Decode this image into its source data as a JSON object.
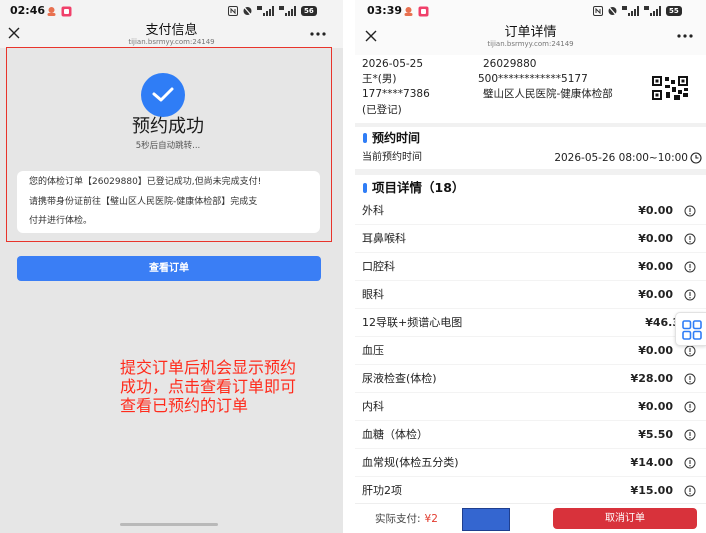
{
  "left_screen": {
    "status_bar": {
      "time": "02:46",
      "battery": "56"
    },
    "header": {
      "title": "支付信息",
      "subtitle": "tijian.bsrmyy.com:24149"
    },
    "success": {
      "title": "预约成功",
      "countdown": "5秒后自动跳转..."
    },
    "notice_lines": [
      "您的体检订单【26029880】已登记成功,但尚未完成支付!",
      "请携带身份证前往【璧山区人民医院-健康体检部】完成支",
      "付并进行体检。"
    ],
    "view_order_button": "查看订单",
    "annotation_lines": [
      "提交订单后机会显示预约",
      "成功，点击查看订单即可",
      "查看已预约的订单"
    ]
  },
  "right_screen": {
    "status_bar": {
      "time": "03:39",
      "battery": "55"
    },
    "header": {
      "title": "订单详情",
      "subtitle": "tijian.bsrmyy.com:24149"
    },
    "order": {
      "date": "2026-05-25",
      "order_no": "26029880",
      "name": "王*(男)",
      "id_no": "500************5177",
      "phone": "177****7386",
      "hospital": "璧山区人民医院-健康体检部",
      "status": "(已登记)"
    },
    "appointment": {
      "section_title": "预约时间",
      "label": "当前预约时间",
      "time": "2026-05-26 08:00~10:00"
    },
    "items_section": {
      "title": "项目详情（18）",
      "items": [
        {
          "name": "外科",
          "price": "¥0.00"
        },
        {
          "name": "耳鼻喉科",
          "price": "¥0.00"
        },
        {
          "name": "口腔科",
          "price": "¥0.00"
        },
        {
          "name": "眼科",
          "price": "¥0.00"
        },
        {
          "name": "12导联+频谱心电图",
          "price": "¥46.3"
        },
        {
          "name": "血压",
          "price": "¥0.00"
        },
        {
          "name": "尿液检查(体检)",
          "price": "¥28.00"
        },
        {
          "name": "内科",
          "price": "¥0.00"
        },
        {
          "name": "血糖（体检）",
          "price": "¥5.50"
        },
        {
          "name": "血常规(体检五分类)",
          "price": "¥14.00"
        },
        {
          "name": "肝功2项",
          "price": "¥15.00"
        }
      ]
    },
    "footer": {
      "paid_label": "实际支付:",
      "paid_amount": "¥2",
      "cancel_button": "取消订单"
    }
  },
  "colors": {
    "accent_blue": "#2f7df6",
    "annotation_red": "#ff2b1c",
    "highlight_border": "#e8342b",
    "cancel_red": "#d8323b",
    "redaction_blue": "#3466d0"
  },
  "icons": [
    "close-icon",
    "more-icon",
    "check-icon",
    "qr-code-icon",
    "clock-icon",
    "info-icon",
    "grid-menu-icon",
    "signal-icon",
    "battery-icon",
    "notification-icon"
  ]
}
